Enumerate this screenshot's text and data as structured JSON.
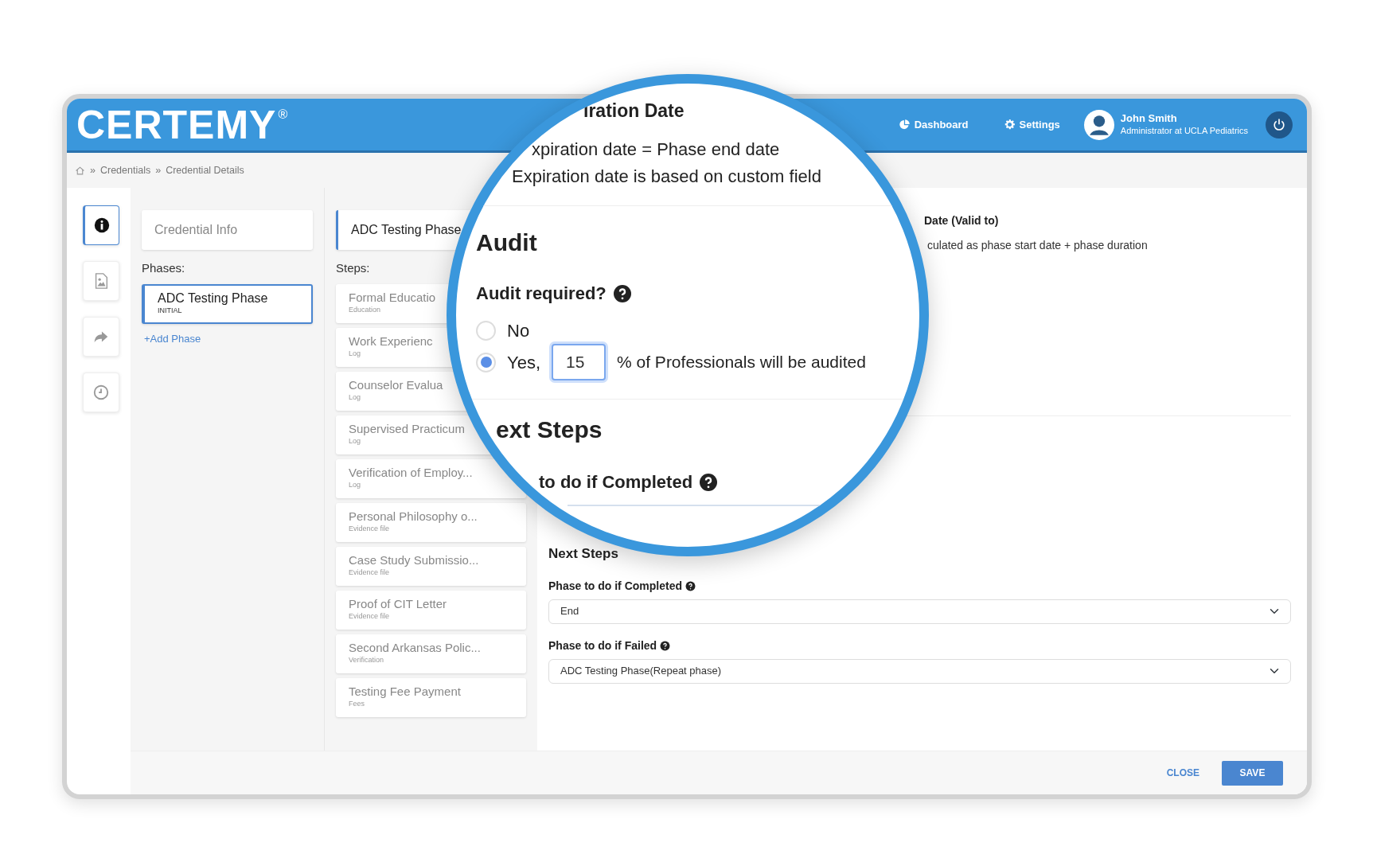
{
  "brand": {
    "logo": "CERTEMY",
    "mark": "®"
  },
  "nav": [
    {
      "label": "Dashboard"
    },
    {
      "label": "Settings"
    }
  ],
  "user": {
    "name": "John Smith",
    "role": "Administrator at UCLA Pediatrics"
  },
  "breadcrumb": {
    "separator": "»",
    "items": [
      "Credentials",
      "Credential Details"
    ]
  },
  "rail": [
    {
      "selected": true
    },
    {
      "selected": false
    },
    {
      "selected": false
    },
    {
      "selected": false
    }
  ],
  "credential_info": "Credential Info",
  "phases_label": "Phases:",
  "phases": [
    {
      "title": "ADC Testing Phase",
      "subtitle": "INITIAL",
      "selected": true
    }
  ],
  "add_phase": "+Add Phase",
  "steps_header": "ADC Testing Phase",
  "steps_label": "Steps:",
  "steps": [
    {
      "title": "Formal Educatio",
      "type": "Education",
      "selected": false
    },
    {
      "title": "Work Experienc",
      "type": "Log",
      "selected": false
    },
    {
      "title": "Counselor Evalua",
      "type": "Log",
      "selected": false
    },
    {
      "title": "Supervised Practicum",
      "type": "Log",
      "selected": false
    },
    {
      "title": "Verification of Employ...",
      "type": "Log",
      "selected": false
    },
    {
      "title": "Personal Philosophy o...",
      "type": "Evidence file",
      "selected": false
    },
    {
      "title": "Case Study Submissio...",
      "type": "Evidence file",
      "selected": false
    },
    {
      "title": "Proof of CIT Letter",
      "type": "Evidence file",
      "selected": false
    },
    {
      "title": "Second Arkansas Polic...",
      "type": "Verification",
      "selected": false
    },
    {
      "title": "Testing Fee Payment",
      "type": "Fees",
      "selected": false
    }
  ],
  "detail": {
    "valid_to_label": "Date (Valid to)",
    "valid_to_text": "culated as phase start date + phase duration",
    "next_steps": {
      "title": "Next Steps",
      "fields": [
        {
          "label": "Phase to do if Completed",
          "value": "End"
        },
        {
          "label": "Phase to do if Failed",
          "value": "ADC Testing Phase(Repeat phase)"
        }
      ]
    }
  },
  "magnifier": {
    "expiration_title": "iration Date",
    "expiration_lines": [
      "xpiration date = Phase end date",
      "Expiration date is based on custom field"
    ],
    "audit": {
      "title": "Audit",
      "question": "Audit required?",
      "options": [
        {
          "label": "No",
          "selected": false
        },
        {
          "label": "Yes,",
          "selected": true
        }
      ],
      "percent": "15",
      "suffix": "% of Professionals will be audited"
    },
    "next_title": "ext Steps",
    "completed_label": "to do if Completed"
  },
  "footer": {
    "close": "CLOSE",
    "save": "SAVE"
  }
}
